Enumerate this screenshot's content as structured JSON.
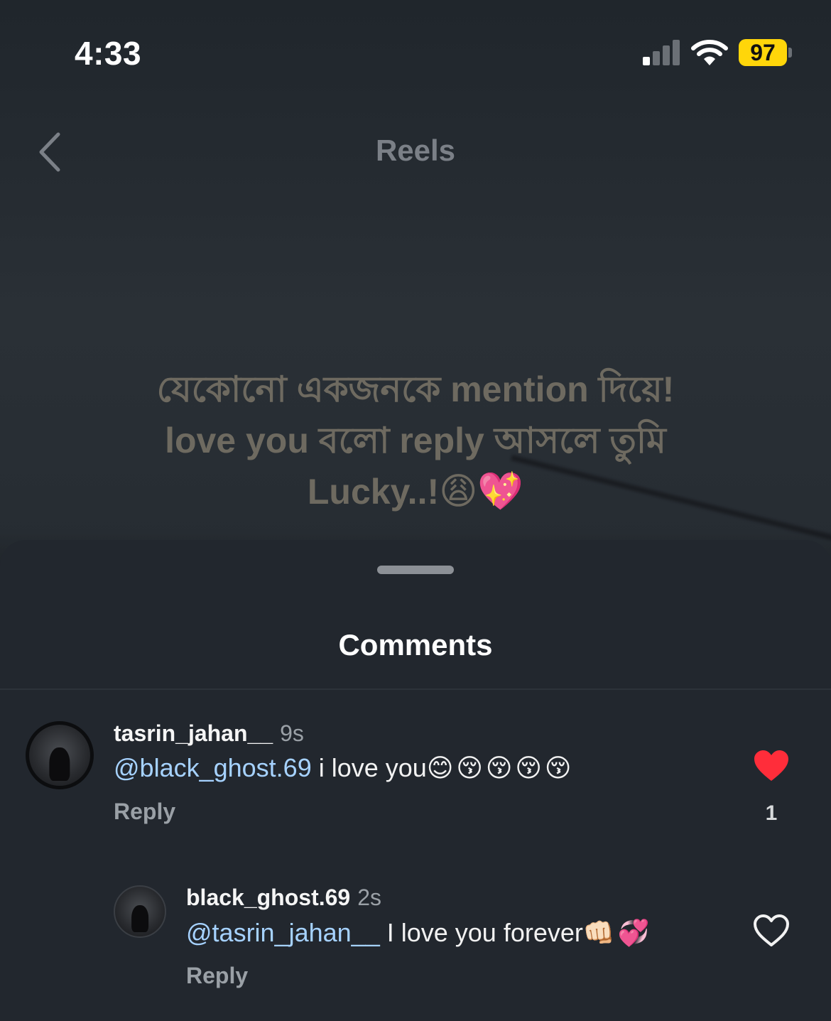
{
  "status_bar": {
    "time": "4:33",
    "battery": "97",
    "signal_bars_active": 1
  },
  "header": {
    "title": "Reels"
  },
  "caption": {
    "line1": "যেকোনো একজনকে mention দিয়ে!",
    "line2": "love you বলো reply আসলে তুমি",
    "line3": "Lucky..!",
    "line3_emoji": "😩💖"
  },
  "sheet": {
    "title": "Comments"
  },
  "comments": [
    {
      "username": "tasrin_jahan__",
      "time": "9s",
      "mention": "@black_ghost.69",
      "text": " i love you",
      "emoji": "😊😚😚😚😚",
      "reply_label": "Reply",
      "liked": true,
      "like_count": "1"
    },
    {
      "username": "black_ghost.69",
      "time": "2s",
      "mention": "@tasrin_jahan__",
      "text": " I love you forever",
      "emoji": "👊🏻💞",
      "reply_label": "Reply",
      "liked": false
    }
  ],
  "colors": {
    "accent_mention": "#a6d2ff",
    "like_red": "#ff2d3a",
    "battery_yellow": "#ffd60a"
  },
  "icons": [
    "chevron-left-icon",
    "heart-filled-icon",
    "heart-outline-icon",
    "wifi-icon",
    "signal-icon"
  ]
}
